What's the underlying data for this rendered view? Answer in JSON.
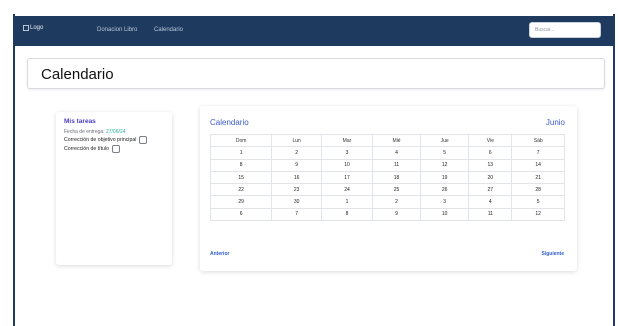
{
  "navbar": {
    "logo_alt": "Logo",
    "links": [
      "Donacion Libro",
      "Calendario"
    ],
    "search_placeholder": "Buscar..."
  },
  "page": {
    "title": "Calendario"
  },
  "tasks": {
    "title": "Mis tareas",
    "due_label": "Fecha de entrega:",
    "due_date": "27/06/24",
    "items": [
      "Corrección de objetivo principal",
      "Corrección de título"
    ]
  },
  "calendar": {
    "title": "Calendario",
    "month": "Junio",
    "weekdays": [
      "Dom",
      "Lun",
      "Mar",
      "Mié",
      "Jue",
      "Vie",
      "Sáb"
    ],
    "weeks": [
      [
        "1",
        "2",
        "3",
        "4",
        "5",
        "6",
        "7"
      ],
      [
        "8",
        "9",
        "10",
        "11",
        "12",
        "13",
        "14"
      ],
      [
        "15",
        "16",
        "17",
        "18",
        "19",
        "20",
        "21"
      ],
      [
        "22",
        "23",
        "24",
        "25",
        "26",
        "27",
        "28"
      ],
      [
        "29",
        "30",
        "1",
        "2",
        "3",
        "4",
        "5"
      ],
      [
        "6",
        "7",
        "8",
        "9",
        "10",
        "11",
        "12"
      ]
    ],
    "prev_label": "Anterior",
    "next_label": "Siguiente"
  },
  "colors": {
    "navbar": "#1e3a5f",
    "accent_blue": "#3d5ec9",
    "tasks_title": "#4a3fc7",
    "due_date": "#2bb3a3"
  }
}
